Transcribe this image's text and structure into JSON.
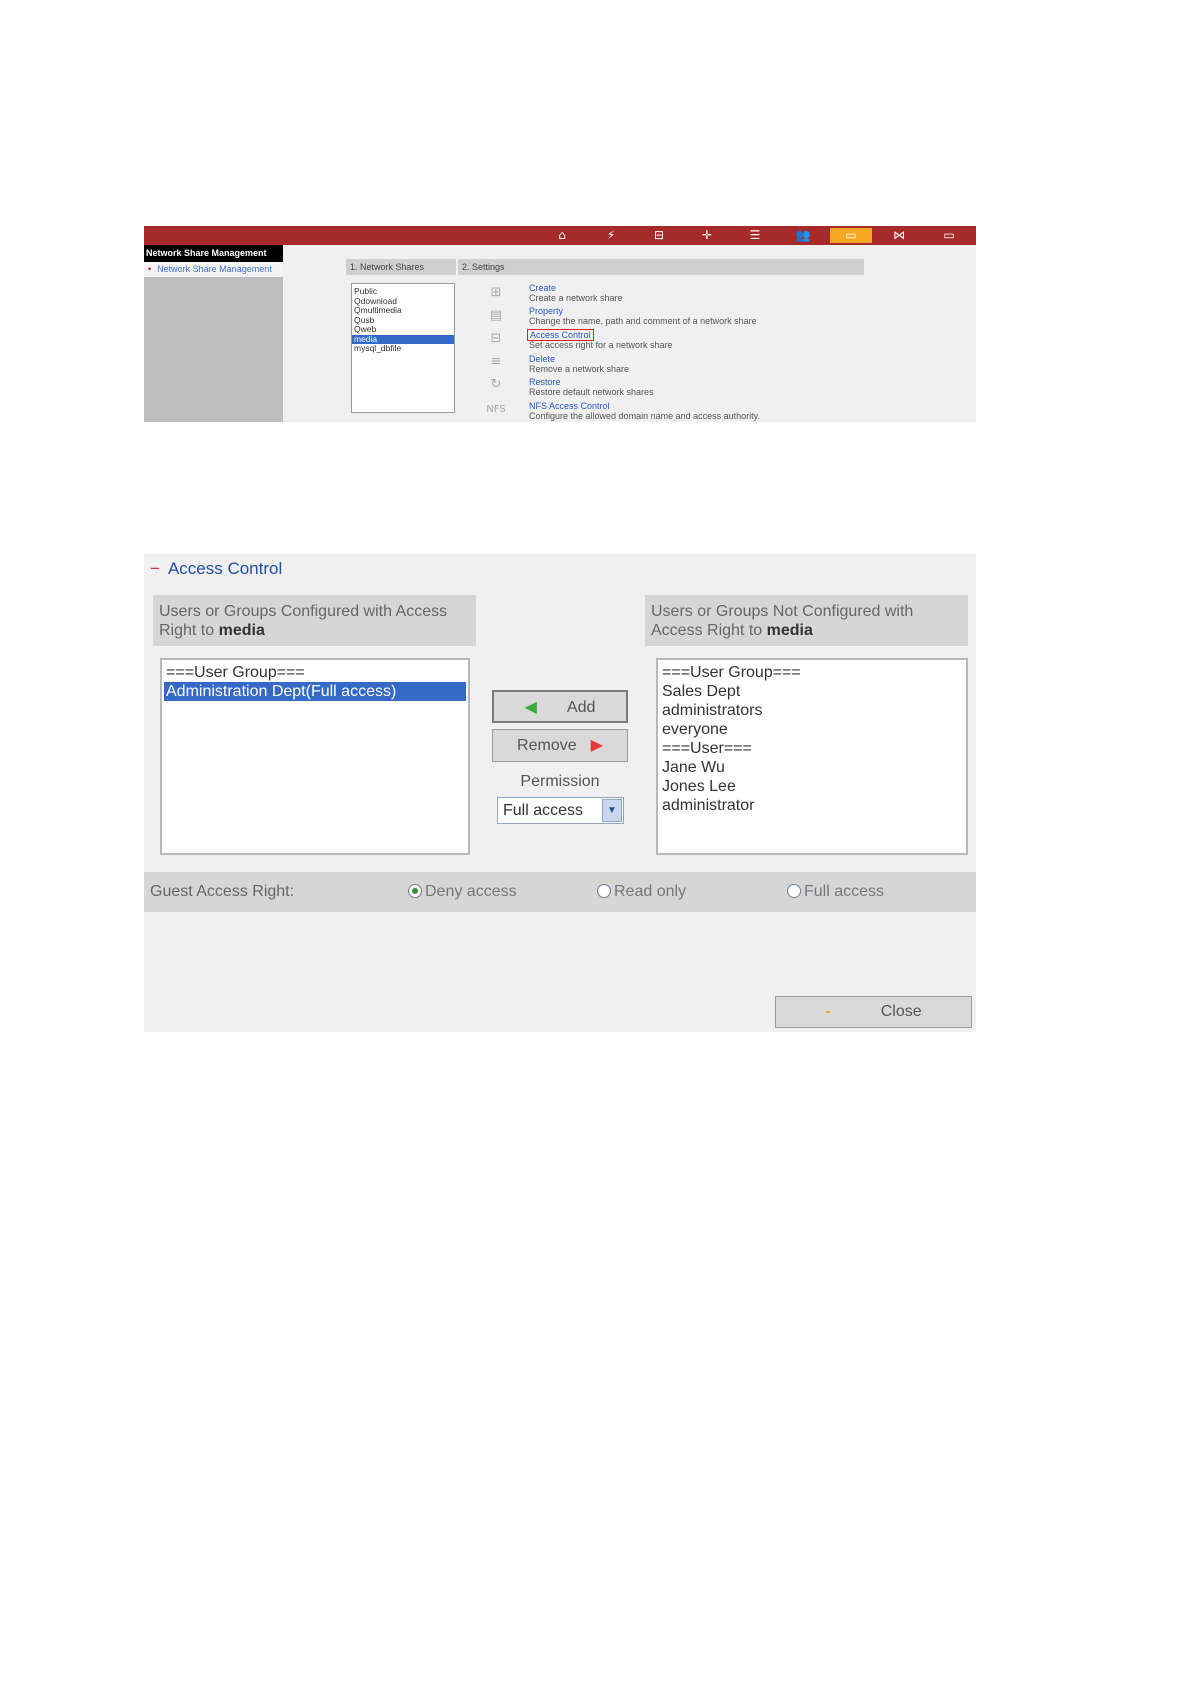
{
  "screen1": {
    "nav_icons": [
      "home-icon",
      "network-icon",
      "device-icon",
      "plus-icon",
      "storage-icon",
      "users-icon",
      "folder-icon",
      "share-icon",
      "apps-icon"
    ],
    "nav_glyphs": [
      "⌂",
      "⚡",
      "⊟",
      "✛",
      "☰",
      "👥",
      "▭",
      "⋈",
      "▭"
    ],
    "sidebar": {
      "title": "Network Share Management",
      "item": "Network Share Management"
    },
    "tabs": {
      "network_shares": "1. Network Shares",
      "settings": "2. Settings"
    },
    "shares": [
      "Public",
      "Qdownload",
      "Qmultimedia",
      "Qusb",
      "Qweb",
      "media",
      "mysql_dbfile"
    ],
    "selected_share": "media",
    "settings": [
      {
        "link": "Create",
        "desc": "Create a network share",
        "icon": "create-share-icon",
        "glyph": "⊞"
      },
      {
        "link": "Property",
        "desc": "Change the name, path and comment of a network share",
        "icon": "property-icon",
        "glyph": "▤"
      },
      {
        "link": "Access Control",
        "desc": "Set access right for a network share",
        "icon": "lock-icon",
        "glyph": "⊟"
      },
      {
        "link": "Delete",
        "desc": "Remove a network share",
        "icon": "delete-icon",
        "glyph": "≡"
      },
      {
        "link": "Restore",
        "desc": "Restore default network shares",
        "icon": "restore-icon",
        "glyph": "↻"
      },
      {
        "link": "NFS Access Control",
        "desc": "Configure the allowed domain name and access authority.",
        "icon": "nfs-icon",
        "glyph": "NFS"
      }
    ]
  },
  "screen2": {
    "title": "Access Control",
    "configured_header_prefix": "Users or Groups Configured with Access Right to",
    "not_configured_header_prefix": "Users or Groups Not Configured with Access Right to",
    "share_name": "media",
    "configured_list": [
      "===User Group===",
      "Administration Dept(Full access)"
    ],
    "configured_selected": "Administration Dept(Full access)",
    "not_configured_list": [
      "===User Group===",
      "Sales Dept",
      "administrators",
      "everyone",
      "===User===",
      "Jane Wu",
      "Jones Lee",
      "administrator"
    ],
    "add_label": "Add",
    "remove_label": "Remove",
    "permission_label": "Permission",
    "permission_value": "Full access",
    "guest_label": "Guest Access Right:",
    "guest_options": [
      "Deny access",
      "Read only",
      "Full access"
    ],
    "guest_selected": "Deny access",
    "close_label": "Close",
    "colors": {
      "accent": "#1f4fa7",
      "selection": "#3469c7",
      "topbar": "#a52a2a",
      "active_tab": "#f5a623"
    }
  }
}
